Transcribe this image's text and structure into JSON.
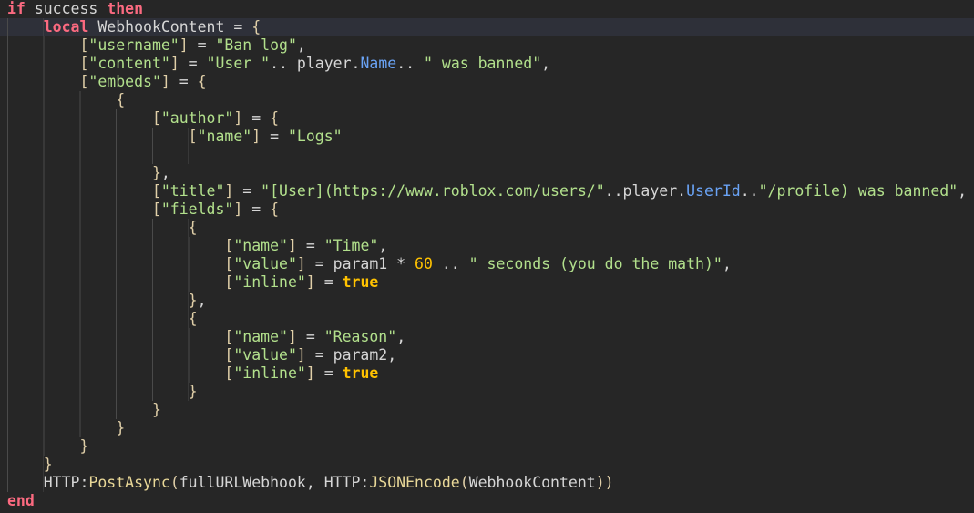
{
  "editor": {
    "language": "lua",
    "current_line": 2,
    "cursor_after_line_2": true,
    "lines": [
      {
        "indent": 0,
        "tokens": [
          [
            "k",
            "if"
          ],
          [
            "t",
            " success "
          ],
          [
            "k",
            "then"
          ]
        ]
      },
      {
        "indent": 4,
        "tokens": [
          [
            "k",
            "local"
          ],
          [
            "t",
            " WebhookContent = "
          ],
          [
            "p",
            "{"
          ]
        ]
      },
      {
        "indent": 8,
        "tokens": [
          [
            "p",
            "["
          ],
          [
            "s",
            "\"username\""
          ],
          [
            "p",
            "]"
          ],
          [
            "t",
            " = "
          ],
          [
            "s",
            "\"Ban log\""
          ],
          [
            "t",
            ","
          ]
        ]
      },
      {
        "indent": 8,
        "tokens": [
          [
            "p",
            "["
          ],
          [
            "s",
            "\"content\""
          ],
          [
            "p",
            "]"
          ],
          [
            "t",
            " = "
          ],
          [
            "s",
            "\"User \""
          ],
          [
            "t",
            ".. player."
          ],
          [
            "m",
            "Name"
          ],
          [
            "t",
            ".. "
          ],
          [
            "s",
            "\" was banned\""
          ],
          [
            "t",
            ","
          ]
        ]
      },
      {
        "indent": 8,
        "tokens": [
          [
            "p",
            "["
          ],
          [
            "s",
            "\"embeds\""
          ],
          [
            "p",
            "]"
          ],
          [
            "t",
            " = "
          ],
          [
            "p",
            "{"
          ]
        ]
      },
      {
        "indent": 12,
        "tokens": [
          [
            "p",
            "{"
          ]
        ]
      },
      {
        "indent": 16,
        "tokens": [
          [
            "p",
            "["
          ],
          [
            "s",
            "\"author\""
          ],
          [
            "p",
            "]"
          ],
          [
            "t",
            " = "
          ],
          [
            "p",
            "{"
          ]
        ]
      },
      {
        "indent": 20,
        "tokens": [
          [
            "p",
            "["
          ],
          [
            "s",
            "\"name\""
          ],
          [
            "p",
            "]"
          ],
          [
            "t",
            " = "
          ],
          [
            "s",
            "\"Logs\""
          ]
        ]
      },
      {
        "indent": 20,
        "tokens": []
      },
      {
        "indent": 16,
        "tokens": [
          [
            "p",
            "}"
          ],
          [
            "t",
            ","
          ]
        ]
      },
      {
        "indent": 16,
        "tokens": [
          [
            "p",
            "["
          ],
          [
            "s",
            "\"title\""
          ],
          [
            "p",
            "]"
          ],
          [
            "t",
            " = "
          ],
          [
            "s",
            "\"[User](https://www.roblox.com/users/\""
          ],
          [
            "t",
            ".."
          ],
          [
            "t",
            "player."
          ],
          [
            "m",
            "UserId"
          ],
          [
            "t",
            ".."
          ],
          [
            "s",
            "\"/profile) was banned\""
          ],
          [
            "t",
            ","
          ]
        ]
      },
      {
        "indent": 16,
        "tokens": [
          [
            "p",
            "["
          ],
          [
            "s",
            "\"fields\""
          ],
          [
            "p",
            "]"
          ],
          [
            "t",
            " = "
          ],
          [
            "p",
            "{"
          ]
        ]
      },
      {
        "indent": 20,
        "tokens": [
          [
            "p",
            "{"
          ]
        ]
      },
      {
        "indent": 24,
        "tokens": [
          [
            "p",
            "["
          ],
          [
            "s",
            "\"name\""
          ],
          [
            "p",
            "]"
          ],
          [
            "t",
            " = "
          ],
          [
            "s",
            "\"Time\""
          ],
          [
            "t",
            ","
          ]
        ]
      },
      {
        "indent": 24,
        "tokens": [
          [
            "p",
            "["
          ],
          [
            "s",
            "\"value\""
          ],
          [
            "p",
            "]"
          ],
          [
            "t",
            " = param1 * "
          ],
          [
            "n",
            "60"
          ],
          [
            "t",
            " .. "
          ],
          [
            "s",
            "\" seconds (you do the math)\""
          ],
          [
            "t",
            ","
          ]
        ]
      },
      {
        "indent": 24,
        "tokens": [
          [
            "p",
            "["
          ],
          [
            "s",
            "\"inline\""
          ],
          [
            "p",
            "]"
          ],
          [
            "t",
            " = "
          ],
          [
            "b",
            "true"
          ]
        ]
      },
      {
        "indent": 20,
        "tokens": [
          [
            "p",
            "}"
          ],
          [
            "t",
            ","
          ]
        ]
      },
      {
        "indent": 20,
        "tokens": [
          [
            "p",
            "{"
          ]
        ]
      },
      {
        "indent": 24,
        "tokens": [
          [
            "p",
            "["
          ],
          [
            "s",
            "\"name\""
          ],
          [
            "p",
            "]"
          ],
          [
            "t",
            " = "
          ],
          [
            "s",
            "\"Reason\""
          ],
          [
            "t",
            ","
          ]
        ]
      },
      {
        "indent": 24,
        "tokens": [
          [
            "p",
            "["
          ],
          [
            "s",
            "\"value\""
          ],
          [
            "p",
            "]"
          ],
          [
            "t",
            " = param2,"
          ]
        ]
      },
      {
        "indent": 24,
        "tokens": [
          [
            "p",
            "["
          ],
          [
            "s",
            "\"inline\""
          ],
          [
            "p",
            "]"
          ],
          [
            "t",
            " = "
          ],
          [
            "b",
            "true"
          ]
        ]
      },
      {
        "indent": 20,
        "tokens": [
          [
            "p",
            "}"
          ]
        ]
      },
      {
        "indent": 16,
        "tokens": [
          [
            "p",
            "}"
          ]
        ]
      },
      {
        "indent": 12,
        "tokens": [
          [
            "p",
            "}"
          ]
        ]
      },
      {
        "indent": 8,
        "tokens": [
          [
            "p",
            "}"
          ]
        ]
      },
      {
        "indent": 4,
        "tokens": [
          [
            "p",
            "}"
          ]
        ]
      },
      {
        "indent": 4,
        "tokens": [
          [
            "t",
            "HTTP:"
          ],
          [
            "f",
            "PostAsync"
          ],
          [
            "p",
            "("
          ],
          [
            "t",
            "fullURLWebhook, HTTP:"
          ],
          [
            "f",
            "JSONEncode"
          ],
          [
            "p",
            "("
          ],
          [
            "t",
            "WebhookContent"
          ],
          [
            "p",
            "))"
          ]
        ]
      },
      {
        "indent": 0,
        "tokens": [
          [
            "k",
            "end"
          ]
        ]
      }
    ]
  }
}
